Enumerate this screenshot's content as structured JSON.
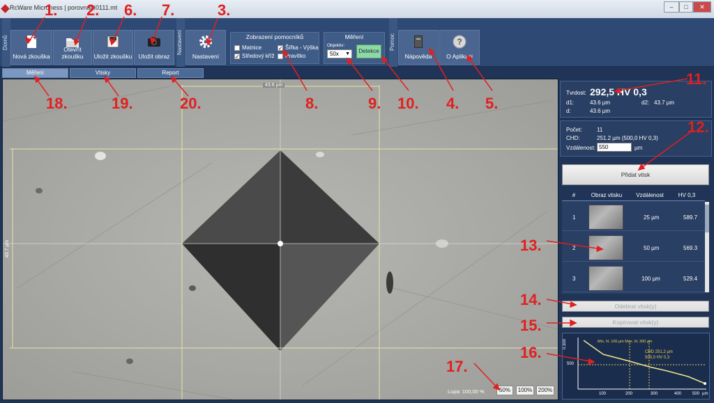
{
  "window": {
    "title": "RcWare Microness | porovnání0111.mt"
  },
  "sections": {
    "domu": "Domů",
    "nastaveni": "Nastavení",
    "pomoc": "Pomoc"
  },
  "toolbar": {
    "nova_zkouska": "Nová zkouška",
    "otevrit_zkousku": "Otevřít zkoušku",
    "ulozit_zkousku": "Uložit zkoušku",
    "ulozit_obraz": "Uložit obraz",
    "nastaveni": "Nastavení",
    "napoveda": "Nápověda",
    "o_aplikaci": "O Aplikaci"
  },
  "helpers": {
    "title": "Zobrazení pomocníků",
    "matnice": "Matnice",
    "stredovy_kriz": "Středový kříž",
    "sirka_vyska": "Šířka - Výška",
    "pravitko": "Pravítko"
  },
  "measure": {
    "title": "Měření",
    "objektiv_label": "Objektiv:",
    "objektiv_value": "50x",
    "detekce": "Detekce"
  },
  "tabs": [
    "Měření",
    "Vtisky",
    "Report"
  ],
  "viewer": {
    "width_label": "43.6 µm",
    "height_label": "43.7 µm",
    "lupa": "Lupa: 100,00 %",
    "zoom": [
      "50%",
      "100%",
      "200%"
    ]
  },
  "result": {
    "tvrdost_label": "Tvrdost:",
    "tvrdost_value": "292,5 HV 0,3",
    "d1_label": "d1:",
    "d1_value": "43.6 µm",
    "d2_label": "d2:",
    "d2_value": "43.7 µm",
    "d_label": "d:",
    "d_value": "43.6 µm"
  },
  "stats": {
    "pocet_label": "Počet:",
    "pocet_value": "11",
    "chd_label": "CHD:",
    "chd_value": "251.2 µm (500,0 HV 0,3)",
    "vzdalenost_label": "Vzdálenost:",
    "vzdalenost_value": "550",
    "unit": "µm"
  },
  "buttons": {
    "pridat": "Přidat vtisk",
    "odebrat": "Odebrat vtisk(y)",
    "kopirovat": "Kopírovat vtisk(y)"
  },
  "table": {
    "headers": [
      "#",
      "Obraz vtisku",
      "Vzdálenost",
      "HV 0,3"
    ],
    "rows": [
      {
        "n": "1",
        "dist": "25 µm",
        "hv": "589.7"
      },
      {
        "n": "2",
        "dist": "50 µm",
        "hv": "569.3"
      },
      {
        "n": "3",
        "dist": "100 µm",
        "hv": "529.4"
      }
    ]
  },
  "graph": {
    "y_tick_top": "0.300",
    "y_tick_mid": "500",
    "x_ticks": [
      "100",
      "200",
      "300",
      "400",
      "500"
    ],
    "x_unit": "µm",
    "min_max": "Min. hl. 100 µm Max. hl. 300 µm",
    "chd_note1": "CHD 251,2 µm",
    "chd_note2": "500,0 HV 0,3",
    "series_color": "#f0e68c"
  },
  "annotations": [
    "1.",
    "2.",
    "6.",
    "7.",
    "3.",
    "11.",
    "12.",
    "13.",
    "14.",
    "15.",
    "16.",
    "17.",
    "18.",
    "19.",
    "20.",
    "8.",
    "9.",
    "10.",
    "4.",
    "5."
  ]
}
